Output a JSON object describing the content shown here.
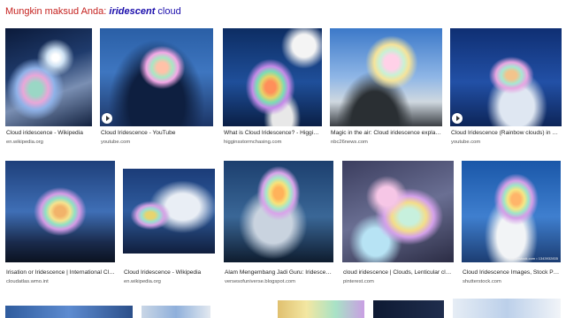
{
  "suggestion": {
    "prefix": "Mungkin maksud Anda: ",
    "term": "iridescent",
    "rest": " cloud"
  },
  "results": [
    {
      "caption": "Cloud iridescence - Wikipedia",
      "source": "en.wikipedia.org",
      "video": false
    },
    {
      "caption": "Cloud Iridescence - YouTube",
      "source": "youtube.com",
      "video": true
    },
    {
      "caption": "What is Cloud Iridescence? - Higgins St...",
      "source": "higginsstormchasing.com",
      "video": false
    },
    {
      "caption": "Magic in the air: Cloud iridescence explained ...",
      "source": "nbc26news.com",
      "video": false
    },
    {
      "caption": "Cloud Iridescence (Rainbow clouds) in Singa...",
      "source": "youtube.com",
      "video": true
    },
    {
      "caption": "Irisation or Iridescence | International Cloud ...",
      "source": "cloudatlas.wmo.int",
      "video": false
    },
    {
      "caption": "Cloud Iridescence - Wikipedia",
      "source": "en.wikipedia.org",
      "video": false
    },
    {
      "caption": "Alam Mengembang Jadi Guru: Iridescent Cl...",
      "source": "versesofuniverse.blogspot.com",
      "video": false
    },
    {
      "caption": "cloud iridescence | Clouds, Lenticular cloud ...",
      "source": "pinterest.com",
      "video": false
    },
    {
      "caption": "Cloud Iridescence Images, Stock Photo...",
      "source": "shutterstock.com",
      "video": false,
      "watermark": "shutterstock.com • 1343932835"
    }
  ]
}
